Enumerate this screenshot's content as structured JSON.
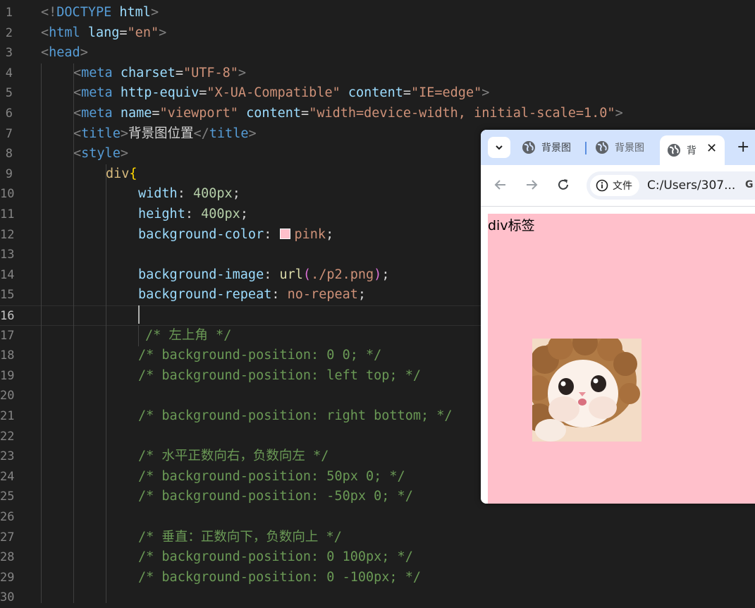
{
  "editor": {
    "lines": [
      {
        "num": "1",
        "tokens": [
          [
            "t-br",
            "<!"
          ],
          [
            "t-tag",
            "DOCTYPE"
          ],
          [
            "t-text",
            " "
          ],
          [
            "t-attr",
            "html"
          ],
          [
            "t-br",
            ">"
          ]
        ]
      },
      {
        "num": "2",
        "tokens": [
          [
            "t-br",
            "<"
          ],
          [
            "t-tag",
            "html"
          ],
          [
            "t-text",
            " "
          ],
          [
            "t-attr",
            "lang"
          ],
          [
            "t-punc",
            "="
          ],
          [
            "t-str",
            "\"en\""
          ],
          [
            "t-br",
            ">"
          ]
        ]
      },
      {
        "num": "3",
        "tokens": [
          [
            "t-br",
            "<"
          ],
          [
            "t-tag",
            "head"
          ],
          [
            "t-br",
            ">"
          ]
        ]
      },
      {
        "num": "4",
        "tokens": [
          [
            "t-br",
            "<"
          ],
          [
            "t-tag",
            "meta"
          ],
          [
            "t-text",
            " "
          ],
          [
            "t-attr",
            "charset"
          ],
          [
            "t-punc",
            "="
          ],
          [
            "t-str",
            "\"UTF-8\""
          ],
          [
            "t-br",
            ">"
          ]
        ]
      },
      {
        "num": "5",
        "tokens": [
          [
            "t-br",
            "<"
          ],
          [
            "t-tag",
            "meta"
          ],
          [
            "t-text",
            " "
          ],
          [
            "t-attr",
            "http-equiv"
          ],
          [
            "t-punc",
            "="
          ],
          [
            "t-str",
            "\"X-UA-Compatible\""
          ],
          [
            "t-text",
            " "
          ],
          [
            "t-attr",
            "content"
          ],
          [
            "t-punc",
            "="
          ],
          [
            "t-str",
            "\"IE=edge\""
          ],
          [
            "t-br",
            ">"
          ]
        ]
      },
      {
        "num": "6",
        "tokens": [
          [
            "t-br",
            "<"
          ],
          [
            "t-tag",
            "meta"
          ],
          [
            "t-text",
            " "
          ],
          [
            "t-attr",
            "name"
          ],
          [
            "t-punc",
            "="
          ],
          [
            "t-str",
            "\"viewport\""
          ],
          [
            "t-text",
            " "
          ],
          [
            "t-attr",
            "content"
          ],
          [
            "t-punc",
            "="
          ],
          [
            "t-str",
            "\"width=device-width, initial-scale=1.0\""
          ],
          [
            "t-br",
            ">"
          ]
        ]
      },
      {
        "num": "7",
        "tokens": [
          [
            "t-br",
            "<"
          ],
          [
            "t-tag",
            "title"
          ],
          [
            "t-br",
            ">"
          ],
          [
            "t-text",
            "背景图位置"
          ],
          [
            "t-br",
            "</"
          ],
          [
            "t-tag",
            "title"
          ],
          [
            "t-br",
            ">"
          ]
        ]
      },
      {
        "num": "8",
        "tokens": [
          [
            "t-br",
            "<"
          ],
          [
            "t-tag",
            "style"
          ],
          [
            "t-br",
            ">"
          ]
        ]
      },
      {
        "num": "9",
        "tokens": [
          [
            "t-sel",
            "div"
          ],
          [
            "t-brace",
            "{"
          ]
        ]
      },
      {
        "num": "10",
        "tokens": [
          [
            "t-prop",
            "width"
          ],
          [
            "t-punc",
            ": "
          ],
          [
            "t-num",
            "400px"
          ],
          [
            "t-punc",
            ";"
          ]
        ]
      },
      {
        "num": "11",
        "tokens": [
          [
            "t-prop",
            "height"
          ],
          [
            "t-punc",
            ": "
          ],
          [
            "t-num",
            "400px"
          ],
          [
            "t-punc",
            ";"
          ]
        ]
      },
      {
        "num": "12",
        "tokens": [
          [
            "t-prop",
            "background-color"
          ],
          [
            "t-punc",
            ": "
          ],
          [
            "swatch",
            ""
          ],
          [
            "t-val",
            "pink"
          ],
          [
            "t-punc",
            ";"
          ]
        ]
      },
      {
        "num": "13",
        "tokens": []
      },
      {
        "num": "14",
        "tokens": [
          [
            "t-prop",
            "background-image"
          ],
          [
            "t-punc",
            ": "
          ],
          [
            "t-fn",
            "url"
          ],
          [
            "t-paren",
            "("
          ],
          [
            "t-val",
            "./p2.png"
          ],
          [
            "t-paren",
            ")"
          ],
          [
            "t-punc",
            ";"
          ]
        ]
      },
      {
        "num": "15",
        "tokens": [
          [
            "t-prop",
            "background-repeat"
          ],
          [
            "t-punc",
            ": "
          ],
          [
            "t-val",
            "no-repeat"
          ],
          [
            "t-punc",
            ";"
          ]
        ]
      },
      {
        "num": "16",
        "tokens": []
      },
      {
        "num": "17",
        "tokens": [
          [
            "t-com",
            "/* 左上角 */"
          ]
        ]
      },
      {
        "num": "18",
        "tokens": [
          [
            "t-com",
            "/* background-position: 0 0; */"
          ]
        ]
      },
      {
        "num": "19",
        "tokens": [
          [
            "t-com",
            "/* background-position: left top; */"
          ]
        ]
      },
      {
        "num": "20",
        "tokens": []
      },
      {
        "num": "21",
        "tokens": [
          [
            "t-com",
            "/* background-position: right bottom; */"
          ]
        ]
      },
      {
        "num": "22",
        "tokens": []
      },
      {
        "num": "23",
        "tokens": [
          [
            "t-com",
            "/* 水平正数向右，负数向左 */"
          ]
        ]
      },
      {
        "num": "24",
        "tokens": [
          [
            "t-com",
            "/* background-position: 50px 0; */"
          ]
        ]
      },
      {
        "num": "25",
        "tokens": [
          [
            "t-com",
            "/* background-position: -50px 0; */"
          ]
        ]
      },
      {
        "num": "26",
        "tokens": []
      },
      {
        "num": "27",
        "tokens": [
          [
            "t-com",
            "/* 垂直：正数向下，负数向上 */"
          ]
        ]
      },
      {
        "num": "28",
        "tokens": [
          [
            "t-com",
            "/* background-position: 0 100px; */"
          ]
        ]
      },
      {
        "num": "29",
        "tokens": [
          [
            "t-com",
            "/* background-position: 0 -100px; */"
          ]
        ]
      },
      {
        "num": "30",
        "tokens": []
      }
    ]
  },
  "browser": {
    "tabs": [
      {
        "label": "背景图",
        "active": false
      },
      {
        "label": "背景图",
        "active": false
      },
      {
        "label": "背",
        "active": true
      }
    ],
    "close_symbol": "✕",
    "new_tab_symbol": "+",
    "site_chip_label": "文件",
    "url": "C:/Users/307...",
    "ext_icon": "G",
    "page_text": "div标签"
  },
  "colors": {
    "editor_bg": "#1e1e1e",
    "tabstrip_bg": "#d3e3fd",
    "pink": "#ffc0cb"
  }
}
